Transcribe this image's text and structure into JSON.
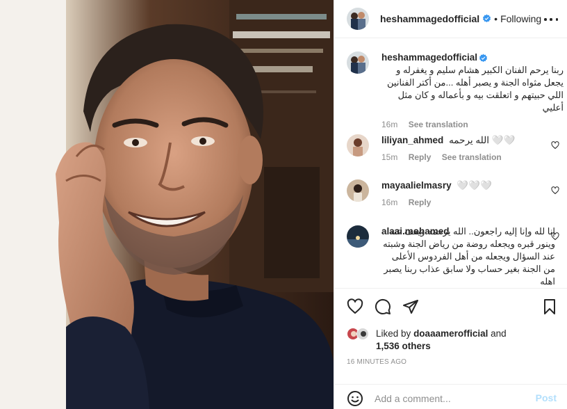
{
  "header": {
    "username": "heshammagedofficial",
    "dot": "•",
    "follow_label": "Following"
  },
  "caption": {
    "username": "heshammagedofficial",
    "text": "ربنا يرحم الفنان الكبير هشام سليم و يغفرله و يجعل مثواه الجنة و يصبر أهله ...من أكتر الفنانين اللي حبيتهم و اتعلقت بيه و بأعماله و كان مثل أعليي",
    "time": "16m",
    "see_translation": "See translation"
  },
  "comments": [
    {
      "username": "liliyan_ahmed",
      "text": "الله يرحمه 🤍🤍",
      "time": "15m",
      "reply": "Reply",
      "see_translation": "See translation"
    },
    {
      "username": "mayaalielmasry",
      "text": "🤍🤍🤍",
      "time": "16m",
      "reply": "Reply"
    },
    {
      "username": "alaai.mohamed",
      "text": "إنا لله وإنا إليه راجعون.. الله يرحمه ويعف عنه وينور قبره ويجعله روضة من رياض الجنة وشبته عند السؤال ويجعله من أهل الفردوس الأعلى من الجنة بغير حساب ولا سابق عذاب ربنا يصبر اهله"
    }
  ],
  "likes": {
    "prefix": "Liked by",
    "user": "doaaamerofficial",
    "and": "and",
    "others": "1,536 others"
  },
  "timestamp": "16 MINUTES AGO",
  "add_comment": {
    "placeholder": "Add a comment...",
    "post_label": "Post"
  },
  "colors": {
    "verified": "#3897f0",
    "post_disabled": "#b2dffc",
    "muted": "#8e8e8e"
  }
}
